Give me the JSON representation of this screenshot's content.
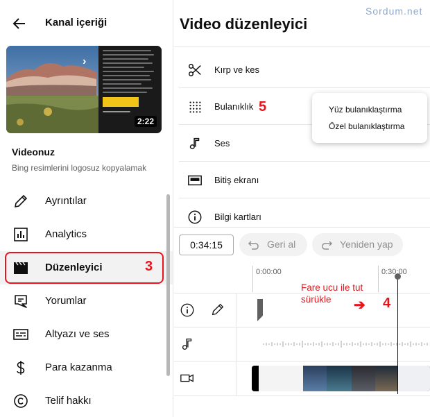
{
  "sidebar": {
    "title": "Kanal içeriği",
    "video": {
      "duration": "2:22",
      "label": "Videonuz",
      "title": "Bing resimlerini logosuz kopyalamak"
    },
    "nav": [
      {
        "label": "Ayrıntılar",
        "icon": "pencil-icon"
      },
      {
        "label": "Analytics",
        "icon": "analytics-icon"
      },
      {
        "label": "Düzenleyici",
        "icon": "clapperboard-icon",
        "active": true
      },
      {
        "label": "Yorumlar",
        "icon": "comments-icon"
      },
      {
        "label": "Altyazı ve ses",
        "icon": "subtitles-icon"
      },
      {
        "label": "Para kazanma",
        "icon": "dollar-icon"
      },
      {
        "label": "Telif hakkı",
        "icon": "copyright-icon"
      }
    ]
  },
  "main": {
    "title": "Video düzenleyici",
    "watermark": "Sordum.net",
    "tools": [
      {
        "label": "Kırp ve kes",
        "icon": "scissors-icon"
      },
      {
        "label": "Bulanıklık",
        "icon": "blur-icon"
      },
      {
        "label": "Ses",
        "icon": "music-note-icon"
      },
      {
        "label": "Bitiş ekranı",
        "icon": "end-screen-icon"
      },
      {
        "label": "Bilgi kartları",
        "icon": "info-icon"
      }
    ],
    "blur_menu": [
      "Yüz bulanıklaştırma",
      "Özel bulanıklaştırma"
    ],
    "controls": {
      "time": "0:34:15",
      "undo_label": "Geri al",
      "redo_label": "Yeniden yap"
    },
    "ruler": [
      "0:00:00",
      "0:30:00"
    ]
  },
  "annotations": {
    "n3": "3",
    "n4": "4",
    "n5": "5",
    "drag_line1": "Fare ucu ile tut",
    "drag_line2": "sürükle",
    "arrow": "➔"
  },
  "colors": {
    "annotation_red": "#e8141c",
    "watermark_blue": "#8fa9c9"
  }
}
